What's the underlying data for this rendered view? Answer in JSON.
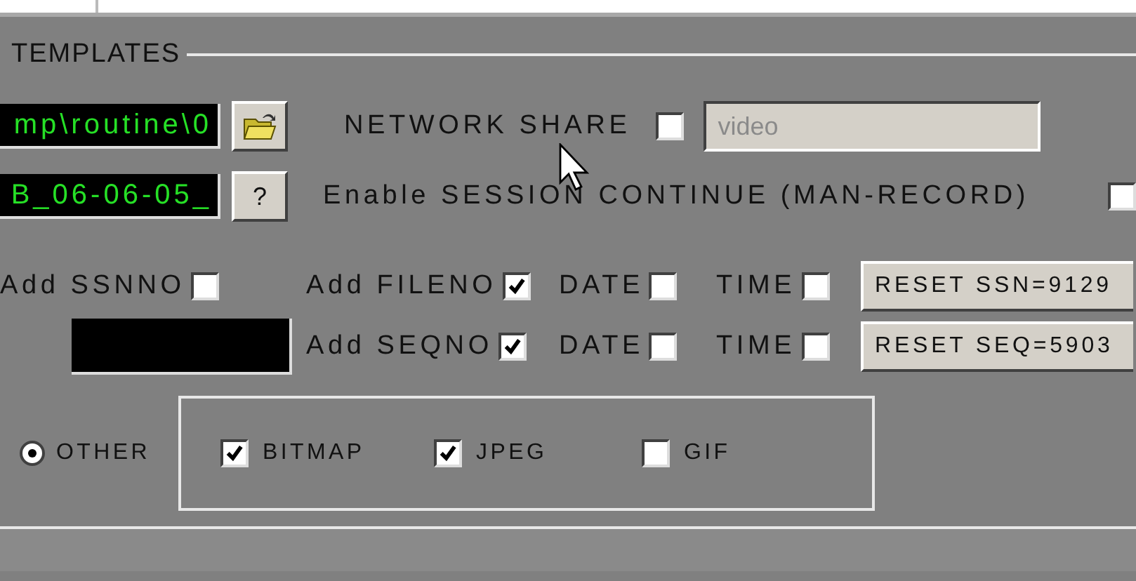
{
  "group": {
    "title": "TEMPLATES"
  },
  "path_field": {
    "value": "mp\\routine\\0"
  },
  "network_share": {
    "label": "NETWORK SHARE",
    "checked": false
  },
  "share_field": {
    "value": "video",
    "disabled": true
  },
  "name_field": {
    "value": "B_06-06-05_"
  },
  "help_button": {
    "label": "?"
  },
  "session_continue": {
    "label": "Enable SESSION CONTINUE (MAN-RECORD)",
    "checked": false
  },
  "number_rows": [
    {
      "lead": {
        "label": "Add SSNNO",
        "checked": false
      },
      "options": [
        {
          "label": "Add FILENO",
          "checked": true
        },
        {
          "label": "DATE",
          "checked": false
        },
        {
          "label": "TIME",
          "checked": false
        }
      ],
      "reset_button": "RESET SSN=9129"
    },
    {
      "options": [
        {
          "label": "Add SEQNO",
          "checked": true
        },
        {
          "label": "DATE",
          "checked": false
        },
        {
          "label": "TIME",
          "checked": false
        }
      ],
      "reset_button": "RESET SEQ=5903"
    }
  ],
  "format_radio": {
    "label": "OTHER",
    "selected": true
  },
  "formats": [
    {
      "label": "BITMAP",
      "checked": true
    },
    {
      "label": "JPEG",
      "checked": true
    },
    {
      "label": "GIF",
      "checked": false
    }
  ]
}
